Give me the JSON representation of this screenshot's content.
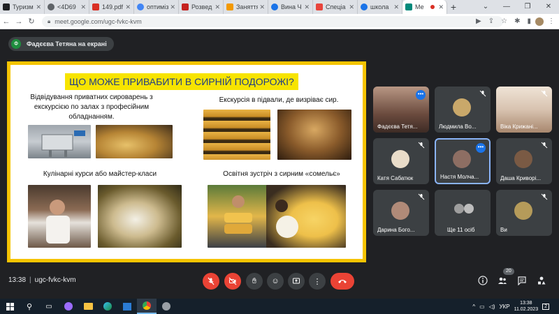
{
  "browser": {
    "tabs": [
      {
        "label": "Туризм",
        "color": "#202124"
      },
      {
        "label": "<4D69",
        "color": "#5f6368"
      },
      {
        "label": "149.pdf",
        "color": "#d93025"
      },
      {
        "label": "оптиміз",
        "color": "#4285f4"
      },
      {
        "label": "Розвед",
        "color": "#c5221f"
      },
      {
        "label": "Заняття",
        "color": "#f29900"
      },
      {
        "label": "Вина Ч",
        "color": "#1a73e8"
      },
      {
        "label": "Спеціа",
        "color": "#e8453c"
      },
      {
        "label": "школа",
        "color": "#1a73e8"
      },
      {
        "label": "Ме",
        "color": "#00897b"
      }
    ],
    "new_tab": "+",
    "url": "meet.google.com/ugc-fvkc-kvm"
  },
  "presenter": {
    "avatar_letter": "Ф",
    "label": "Фадєєва Тетяна на екрані"
  },
  "slide": {
    "title": "ЩО МОЖЕ ПРИВАБИТИ В СИРНІЙ ПОДОРОЖІ?",
    "captions": {
      "top_left": "Відвідування приватних сироварень з екскурсією по залах з професійним обладнанням.",
      "top_right": "Екскурсія в підвали, де визріває сир.",
      "bottom_left": "Кулінарні курси або майстер-класи",
      "bottom_right": "Освітня зустріч з сирним «сомельє»"
    }
  },
  "participants": [
    {
      "name": "Фадєєва Тетя...",
      "type": "video",
      "color": "#6b4b3e"
    },
    {
      "name": "Людмила Во...",
      "type": "avatar",
      "color": "#c9a86a"
    },
    {
      "name": "Віка Крижані...",
      "type": "video",
      "color": "#d8c3b0"
    },
    {
      "name": "Катя Сабатюк",
      "type": "avatar",
      "color": "#e9dcc9"
    },
    {
      "name": "Настя Молча...",
      "type": "avatar",
      "color": "#8d6e63"
    },
    {
      "name": "Даша Криворі...",
      "type": "avatar",
      "color": "#7a5a44"
    },
    {
      "name": "Дарина Бого...",
      "type": "avatar",
      "color": "#b08a78"
    },
    {
      "name": "Ще 11 осіб",
      "type": "group",
      "color": "#9e9e9e"
    },
    {
      "name": "Ви",
      "type": "avatar",
      "color": "#b59b5a"
    }
  ],
  "meeting": {
    "time": "13:38",
    "code": "ugc-fvkc-kvm",
    "people_count": "20"
  },
  "taskbar": {
    "time": "13:38",
    "date": "11.02.2023",
    "lang": "УКР",
    "notifications": "2"
  },
  "colors": {
    "accent": "#f5c400",
    "title_bg": "#f7e400",
    "title_text": "#1f3c88",
    "end_call": "#ea4335",
    "meet_bg": "#202124"
  }
}
